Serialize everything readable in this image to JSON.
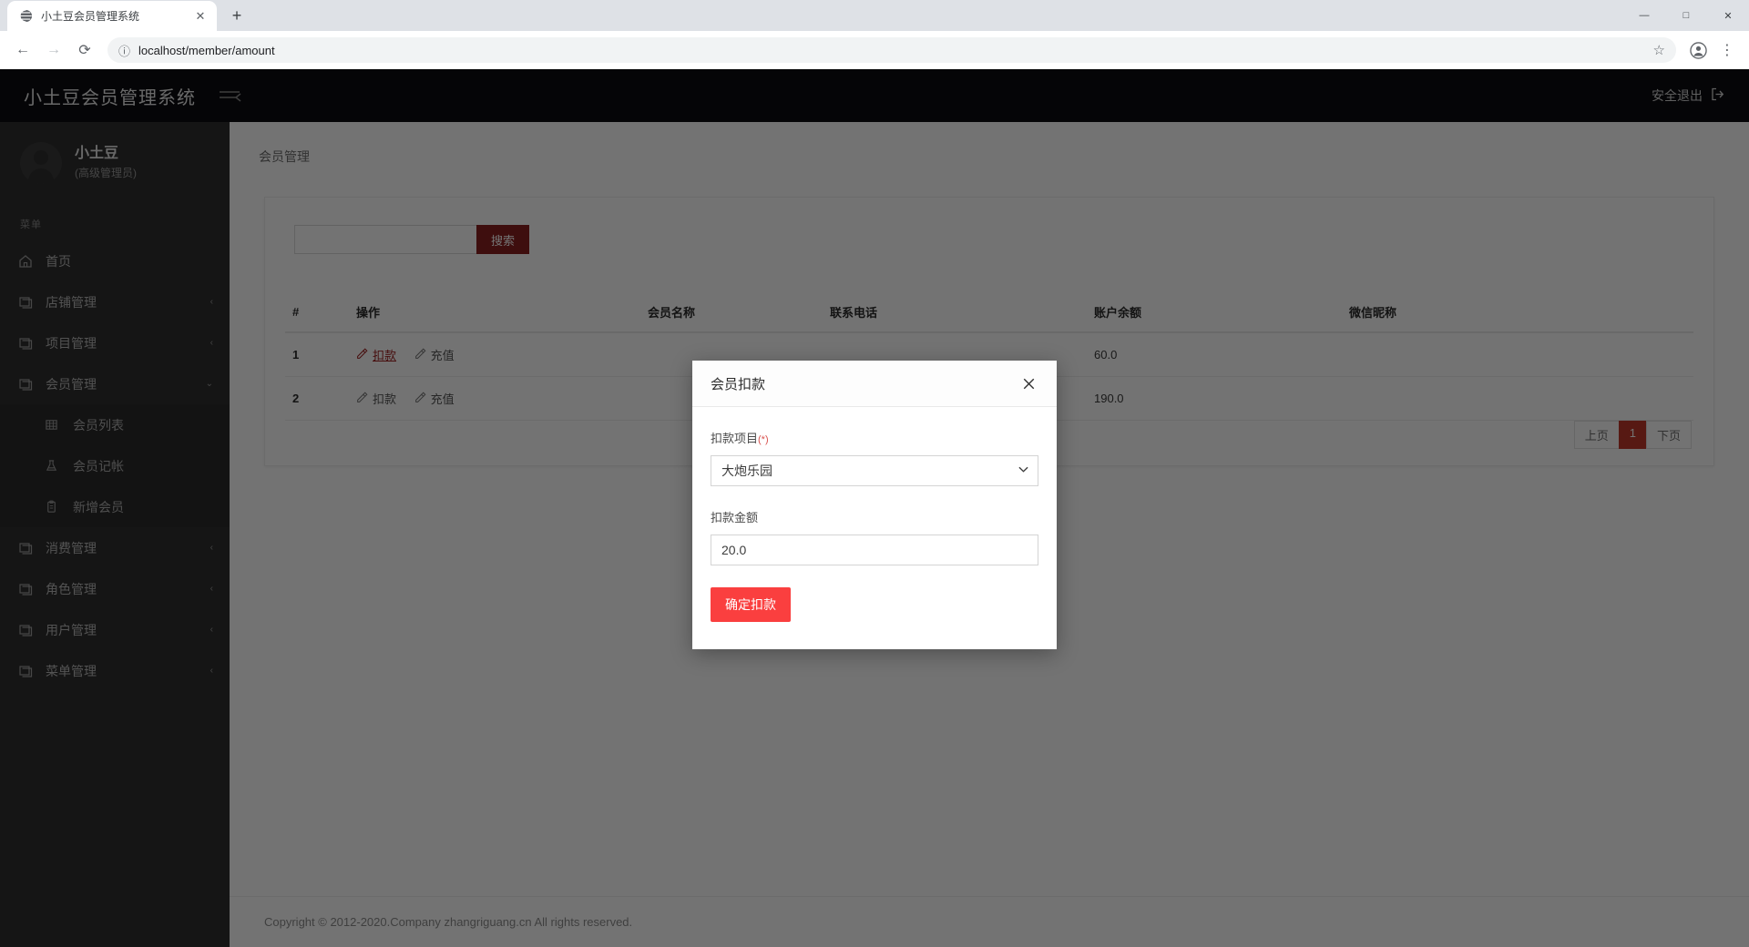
{
  "browser": {
    "tab_title": "小土豆会员管理系统",
    "favicon": "globe-icon",
    "close_tab": "✕",
    "new_tab": "+",
    "window": {
      "minimize": "—",
      "maximize": "□",
      "close": "✕"
    },
    "back": "←",
    "forward": "→",
    "reload": "⟳",
    "site_info": "ⓘ",
    "url": "localhost/member/amount",
    "bookmark": "☆",
    "profile": "account-icon",
    "menu": "⋮"
  },
  "topbar": {
    "brand": "小土豆会员管理系统",
    "toggle_icon": "sidebar-toggle-icon",
    "logout_label": "安全退出",
    "logout_icon": "logout-icon"
  },
  "sidebar": {
    "user_name": "小土豆",
    "user_role": "(高级管理员)",
    "menu_header": "菜单",
    "items": [
      {
        "label": "首页",
        "icon": "home-icon",
        "caret": ""
      },
      {
        "label": "店铺管理",
        "icon": "folder-icon",
        "caret": "‹"
      },
      {
        "label": "项目管理",
        "icon": "folder-icon",
        "caret": "‹"
      },
      {
        "label": "会员管理",
        "icon": "folder-icon",
        "caret": "⌄"
      },
      {
        "label": "消费管理",
        "icon": "folder-icon",
        "caret": "‹"
      },
      {
        "label": "角色管理",
        "icon": "folder-icon",
        "caret": "‹"
      },
      {
        "label": "用户管理",
        "icon": "folder-icon",
        "caret": "‹"
      },
      {
        "label": "菜单管理",
        "icon": "folder-icon",
        "caret": "‹"
      }
    ],
    "submenu": [
      {
        "label": "会员列表",
        "icon": "table-icon"
      },
      {
        "label": "会员记帐",
        "icon": "flask-icon"
      },
      {
        "label": "新增会员",
        "icon": "clipboard-icon"
      }
    ]
  },
  "main": {
    "breadcrumb": "会员管理",
    "search": {
      "value": "",
      "placeholder": "",
      "button_label": "搜索"
    },
    "table": {
      "headers": [
        "#",
        "操作",
        "会员名称",
        "联系电话",
        "账户余额",
        "微信昵称"
      ],
      "rows": [
        {
          "index": "1",
          "ops": [
            {
              "label": "扣款",
              "icon": "edit-icon",
              "active": true
            },
            {
              "label": "充值",
              "icon": "edit-icon",
              "active": false
            }
          ],
          "name": "",
          "phone": "",
          "balance": "60.0",
          "wechat": ""
        },
        {
          "index": "2",
          "ops": [
            {
              "label": "扣款",
              "icon": "edit-icon",
              "active": false
            },
            {
              "label": "充值",
              "icon": "edit-icon",
              "active": false
            }
          ],
          "name": "",
          "phone": "",
          "balance": "190.0",
          "wechat": ""
        }
      ]
    },
    "pager": {
      "prev": "上页",
      "current": "1",
      "next": "下页"
    }
  },
  "footer": {
    "copyright": "Copyright © 2012-2020.Company zhangriguang.cn All rights reserved."
  },
  "modal": {
    "title": "会员扣款",
    "close_icon": "close-icon",
    "project_label": "扣款项目",
    "project_required": "(*)",
    "project_value": "大炮乐园",
    "project_options": [
      "大炮乐园"
    ],
    "amount_label": "扣款金额",
    "amount_value": "20.0",
    "submit_label": "确定扣款",
    "submit_color": "#fa3f3f"
  }
}
